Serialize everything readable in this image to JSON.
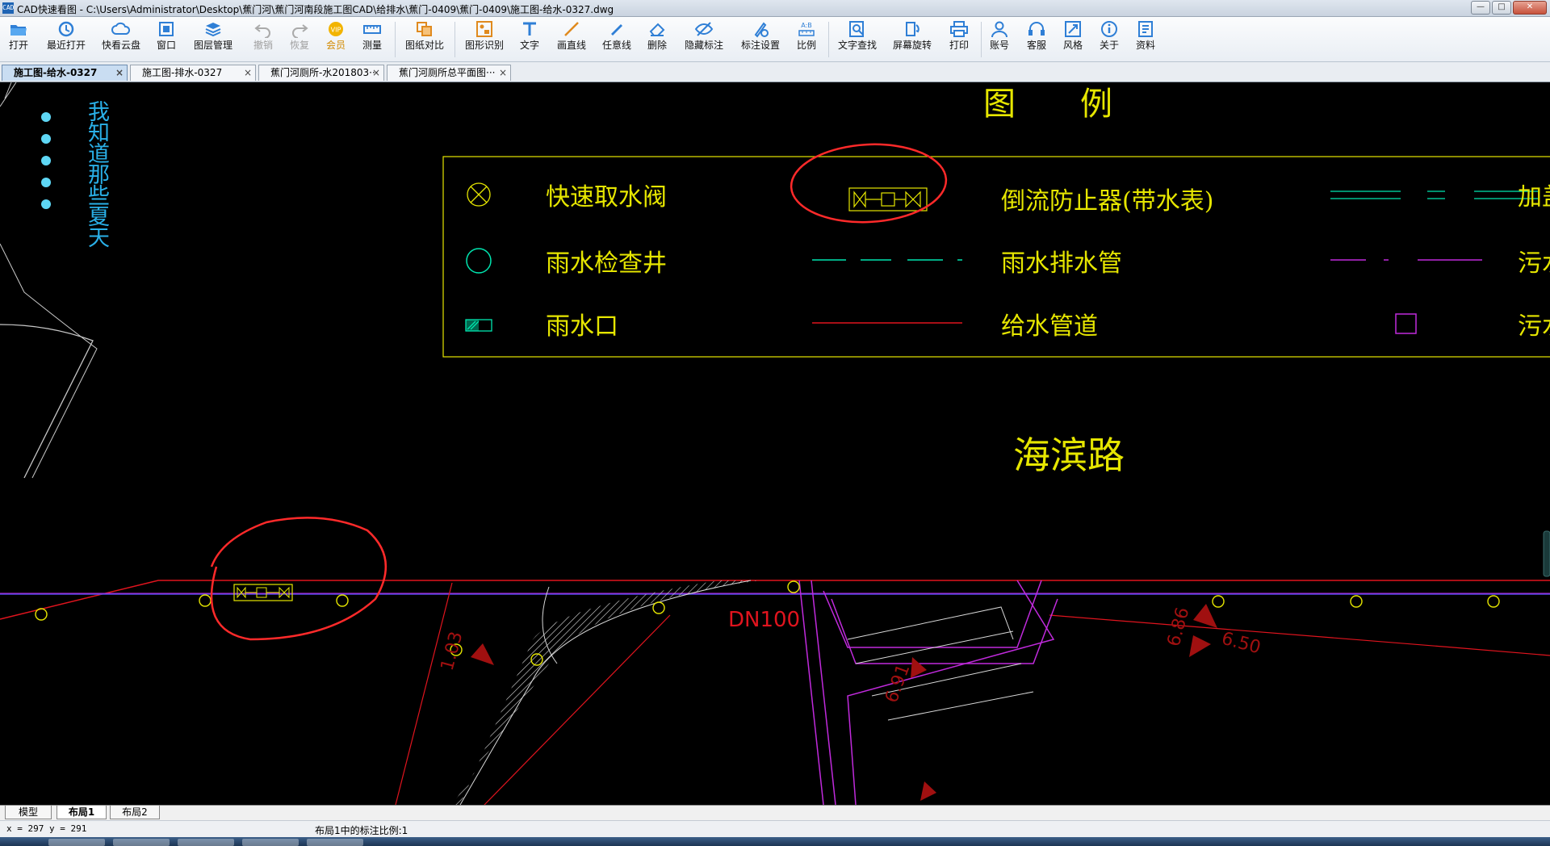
{
  "window": {
    "title": "CAD快速看图 - C:\\Users\\Administrator\\Desktop\\蕉门河\\蕉门河南段施工图CAD\\给排水\\蕉门-0409\\蕉门-0409\\施工图-给水-0327.dwg",
    "app_icon_text": "CAD"
  },
  "toolbar": {
    "items": [
      {
        "label": "打开",
        "icon": "folder-open-icon"
      },
      {
        "label": "最近打开",
        "icon": "recent-icon"
      },
      {
        "label": "快看云盘",
        "icon": "cloud-icon"
      },
      {
        "label": "窗口",
        "icon": "window-icon"
      },
      {
        "label": "图层管理",
        "icon": "layers-icon"
      },
      {
        "label": "撤销",
        "icon": "undo-icon"
      },
      {
        "label": "恢复",
        "icon": "redo-icon"
      },
      {
        "label": "会员",
        "icon": "vip-icon"
      },
      {
        "label": "测量",
        "icon": "ruler-icon"
      },
      {
        "label": "图纸对比",
        "icon": "compare-icon"
      },
      {
        "label": "图形识别",
        "icon": "recognize-icon"
      },
      {
        "label": "文字",
        "icon": "text-icon"
      },
      {
        "label": "画直线",
        "icon": "line-icon"
      },
      {
        "label": "任意线",
        "icon": "freehand-icon"
      },
      {
        "label": "删除",
        "icon": "eraser-icon"
      },
      {
        "label": "隐藏标注",
        "icon": "hide-eye-icon"
      },
      {
        "label": "标注设置",
        "icon": "annotation-settings-icon"
      },
      {
        "label": "比例",
        "icon": "scale-icon"
      },
      {
        "label": "文字查找",
        "icon": "text-search-icon"
      },
      {
        "label": "屏幕旋转",
        "icon": "rotate-icon"
      },
      {
        "label": "打印",
        "icon": "printer-icon"
      },
      {
        "label": "账号",
        "icon": "user-icon"
      },
      {
        "label": "客服",
        "icon": "headset-icon"
      },
      {
        "label": "风格",
        "icon": "style-icon"
      },
      {
        "label": "关于",
        "icon": "info-icon"
      },
      {
        "label": "资料",
        "icon": "docs-icon"
      }
    ]
  },
  "tabs": [
    {
      "label": "施工图-给水-0327",
      "active": true
    },
    {
      "label": "施工图-排水-0327",
      "active": false
    },
    {
      "label": "蕉门河厕所-水201803···",
      "active": false
    },
    {
      "label": "蕉门河厕所总平面图···",
      "active": false
    }
  ],
  "overlay_text": "我知道那些夏天",
  "drawing": {
    "legend_title": "图　　例",
    "legend_items": [
      "快速取水阀",
      "雨水检查井",
      "雨水口",
      "倒流防止器(带水表)",
      "雨水排水管",
      "给水管道",
      "加盖",
      "污水",
      "污水"
    ],
    "road_name": "海滨路",
    "pipe_label": "DN100",
    "elev_1": "1.03",
    "elev_2": "6.86",
    "elev_3": "6.91",
    "elev_4": "6.50"
  },
  "layout_tabs": [
    "模型",
    "布局1",
    "布局2"
  ],
  "active_layout_tab": "布局1",
  "status": {
    "coords": "x = 297  y = 291",
    "scale_text": "布局1中的标注比例:1"
  },
  "colors": {
    "cad_yellow": "#e6e600",
    "cad_cyan": "#00e6b0",
    "cad_red": "#e0141e",
    "cad_magenta": "#c02adc",
    "cad_blue": "#4a4ae8",
    "markup_red": "#ff2a2a",
    "overlay_blue": "#2ab0e8"
  }
}
